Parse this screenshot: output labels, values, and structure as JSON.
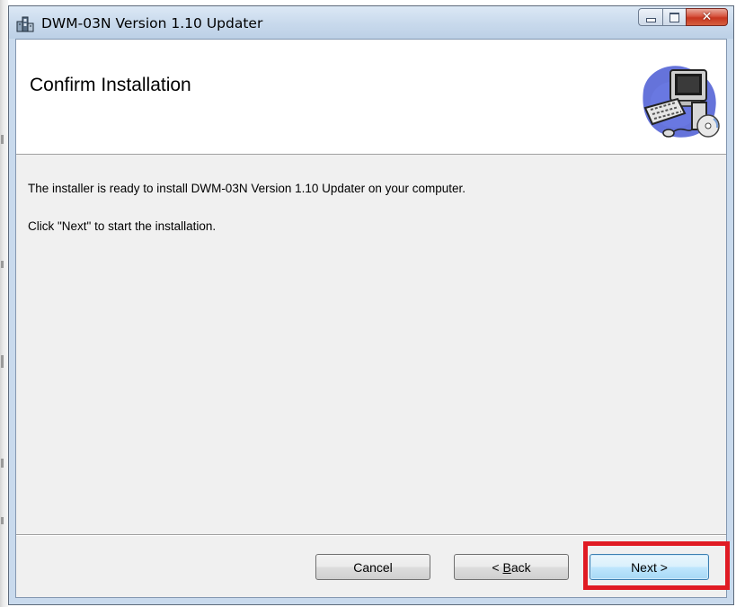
{
  "window": {
    "title": "DWM-03N Version 1.10 Updater",
    "icon": "installer-package-icon",
    "caption_buttons": {
      "minimize_icon": "minimize-icon",
      "maximize_icon": "maximize-icon",
      "close_icon": "close-icon"
    }
  },
  "header": {
    "title": "Confirm Installation",
    "graphic": "computer-setup-icon"
  },
  "body": {
    "line1": "The installer is ready to install DWM-03N Version 1.10 Updater on your computer.",
    "line2": "Click \"Next\" to start the installation."
  },
  "buttons": {
    "cancel": "Cancel",
    "back_prefix": "< ",
    "back_mnemonic": "B",
    "back_rest": "ack",
    "next": "Next >"
  },
  "highlight": {
    "target": "next-button",
    "color": "#e01b24"
  },
  "colors": {
    "titlebar": "#c8d9ec",
    "dialog_background": "#f0f0f0",
    "banner_background": "#ffffff",
    "default_button": "#bee6fd"
  }
}
